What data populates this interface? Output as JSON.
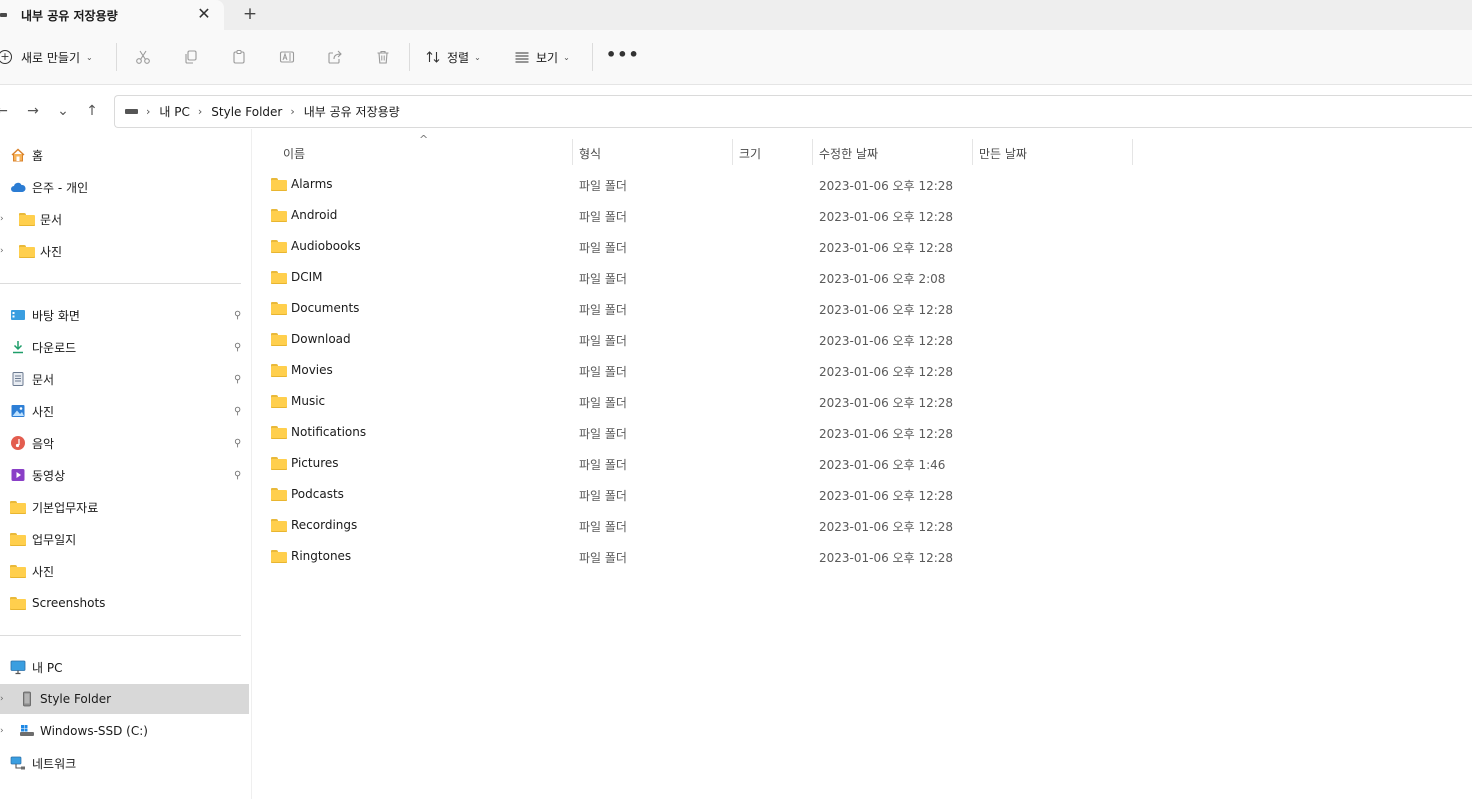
{
  "tab": {
    "title": "내부 공유 저장용량",
    "close_glyph": "✕",
    "new_glyph": "+"
  },
  "toolbar": {
    "new_label": "새로 만들기",
    "sort_label": "정렬",
    "view_label": "보기",
    "more_glyph": "•••"
  },
  "nav": {
    "back": "←",
    "forward": "→",
    "recent": "⌄",
    "up": "↑"
  },
  "breadcrumb": [
    "내 PC",
    "Style Folder",
    "내부 공유 저장용량"
  ],
  "breadcrumb_sep": "›",
  "sidebar": {
    "quick": [
      {
        "label": "홈",
        "icon": "home-icon"
      },
      {
        "label": "은주 - 개인",
        "icon": "cloud-icon"
      },
      {
        "label": "문서",
        "icon": "folder-icon",
        "expandable": true
      },
      {
        "label": "사진",
        "icon": "folder-icon",
        "expandable": true
      }
    ],
    "pinned": [
      {
        "label": "바탕 화면",
        "icon": "desktop-icon",
        "pinned": true
      },
      {
        "label": "다운로드",
        "icon": "download-icon",
        "pinned": true
      },
      {
        "label": "문서",
        "icon": "document-icon",
        "pinned": true
      },
      {
        "label": "사진",
        "icon": "pictures-icon",
        "pinned": true
      },
      {
        "label": "음악",
        "icon": "music-icon",
        "pinned": true
      },
      {
        "label": "동영상",
        "icon": "video-icon",
        "pinned": true
      },
      {
        "label": "기본업무자료",
        "icon": "folder-icon"
      },
      {
        "label": "업무일지",
        "icon": "folder-icon"
      },
      {
        "label": "사진",
        "icon": "folder-icon"
      },
      {
        "label": "Screenshots",
        "icon": "folder-icon"
      }
    ],
    "devices": [
      {
        "label": "내 PC",
        "icon": "pc-icon"
      },
      {
        "label": "Style Folder",
        "icon": "phone-icon",
        "expandable": true,
        "selected": true
      },
      {
        "label": "Windows-SSD (C:)",
        "icon": "drive-icon",
        "expandable": true
      },
      {
        "label": "네트워크",
        "icon": "network-icon"
      }
    ],
    "pin_glyph": "📌",
    "expand_glyph": "›"
  },
  "columns": {
    "name": "이름",
    "type": "형식",
    "size": "크기",
    "modified": "수정한 날짜",
    "created": "만든 날짜"
  },
  "sort_caret": "^",
  "files": [
    {
      "name": "Alarms",
      "type": "파일 폴더",
      "modified": "2023-01-06 오후 12:28"
    },
    {
      "name": "Android",
      "type": "파일 폴더",
      "modified": "2023-01-06 오후 12:28"
    },
    {
      "name": "Audiobooks",
      "type": "파일 폴더",
      "modified": "2023-01-06 오후 12:28"
    },
    {
      "name": "DCIM",
      "type": "파일 폴더",
      "modified": "2023-01-06 오후 2:08"
    },
    {
      "name": "Documents",
      "type": "파일 폴더",
      "modified": "2023-01-06 오후 12:28"
    },
    {
      "name": "Download",
      "type": "파일 폴더",
      "modified": "2023-01-06 오후 12:28"
    },
    {
      "name": "Movies",
      "type": "파일 폴더",
      "modified": "2023-01-06 오후 12:28"
    },
    {
      "name": "Music",
      "type": "파일 폴더",
      "modified": "2023-01-06 오후 12:28"
    },
    {
      "name": "Notifications",
      "type": "파일 폴더",
      "modified": "2023-01-06 오후 12:28"
    },
    {
      "name": "Pictures",
      "type": "파일 폴더",
      "modified": "2023-01-06 오후 1:46"
    },
    {
      "name": "Podcasts",
      "type": "파일 폴더",
      "modified": "2023-01-06 오후 12:28"
    },
    {
      "name": "Recordings",
      "type": "파일 폴더",
      "modified": "2023-01-06 오후 12:28"
    },
    {
      "name": "Ringtones",
      "type": "파일 폴더",
      "modified": "2023-01-06 오후 12:28"
    }
  ],
  "colors": {
    "folder": "#ffcf4d",
    "selected_bg": "#d8d8d8",
    "cloud": "#2b7cd3"
  }
}
